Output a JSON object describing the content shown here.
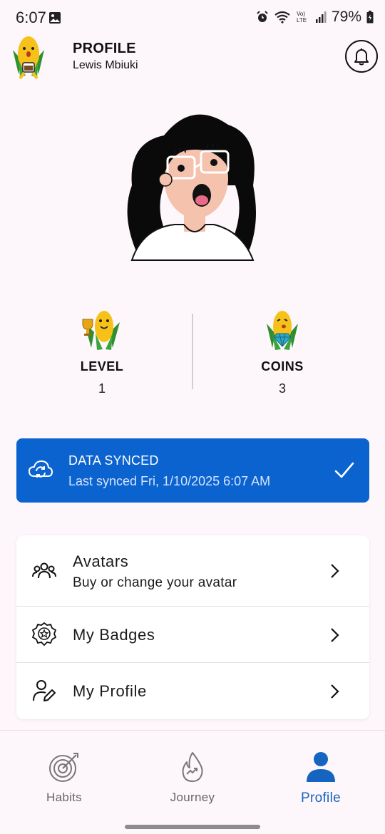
{
  "status_bar": {
    "time": "6:07",
    "battery": "79%",
    "icons": [
      "gallery-icon",
      "alarm-icon",
      "wifi-icon",
      "volte-icon",
      "signal-icon",
      "battery-icon"
    ]
  },
  "header": {
    "title": "PROFILE",
    "username": "Lewis Mbiuki",
    "icons": [
      "mascot-icon",
      "bell-icon"
    ]
  },
  "stats": [
    {
      "label": "LEVEL",
      "value": "1",
      "icon": "trophy-mascot-icon"
    },
    {
      "label": "COINS",
      "value": "3",
      "icon": "gem-mascot-icon"
    }
  ],
  "sync": {
    "title": "DATA SYNCED",
    "subtitle": "Last synced Fri, 1/10/2025 6:07 AM",
    "icons": [
      "cloud-sync-icon",
      "check-icon"
    ]
  },
  "menu": [
    {
      "title": "Avatars",
      "subtitle": "Buy or change your avatar",
      "icon": "group-icon"
    },
    {
      "title": "My Badges",
      "icon": "badge-icon"
    },
    {
      "title": "My Profile",
      "icon": "user-edit-icon"
    }
  ],
  "bottom_nav": [
    {
      "label": "Habits",
      "icon": "target-icon",
      "active": false
    },
    {
      "label": "Journey",
      "icon": "flame-icon",
      "active": false
    },
    {
      "label": "Profile",
      "icon": "person-icon",
      "active": true
    }
  ],
  "colors": {
    "background": "#FDF6FB",
    "accent": "#0A63CF",
    "active_nav": "#1565C0",
    "card": "#FFFFFF"
  }
}
